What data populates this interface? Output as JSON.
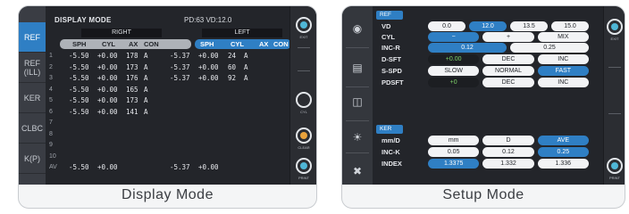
{
  "display_mode": {
    "caption": "Display Mode",
    "title": "DISPLAY MODE",
    "pd": "PD:63",
    "vd": "VD:12.0",
    "right_label": "RIGHT",
    "left_label": "LEFT",
    "sidebar": [
      {
        "label": "REF",
        "active": true
      },
      {
        "label": "REF\n(ILL)",
        "active": false
      },
      {
        "label": "KER",
        "active": false
      },
      {
        "label": "CLBC",
        "active": false
      },
      {
        "label": "K(P)",
        "active": false
      }
    ],
    "headers": [
      "SPH",
      "CYL",
      "AX",
      "CON",
      "SPH",
      "CYL",
      "AX",
      "CON"
    ],
    "rows": [
      {
        "n": "1",
        "r_sph": "-5.50",
        "r_cyl": "+0.00",
        "r_ax": "178",
        "r_con": "A",
        "l_sph": "-5.37",
        "l_cyl": "+0.00",
        "l_ax": "24",
        "l_con": "A"
      },
      {
        "n": "2",
        "r_sph": "-5.50",
        "r_cyl": "+0.00",
        "r_ax": "173",
        "r_con": "A",
        "l_sph": "-5.37",
        "l_cyl": "+0.00",
        "l_ax": "60",
        "l_con": "A"
      },
      {
        "n": "3",
        "r_sph": "-5.50",
        "r_cyl": "+0.00",
        "r_ax": "176",
        "r_con": "A",
        "l_sph": "-5.37",
        "l_cyl": "+0.00",
        "l_ax": "92",
        "l_con": "A"
      },
      {
        "n": "4",
        "r_sph": "-5.50",
        "r_cyl": "+0.00",
        "r_ax": "165",
        "r_con": "A",
        "l_sph": "",
        "l_cyl": "",
        "l_ax": "",
        "l_con": ""
      },
      {
        "n": "5",
        "r_sph": "-5.50",
        "r_cyl": "+0.00",
        "r_ax": "173",
        "r_con": "A",
        "l_sph": "",
        "l_cyl": "",
        "l_ax": "",
        "l_con": ""
      },
      {
        "n": "6",
        "r_sph": "-5.50",
        "r_cyl": "+0.00",
        "r_ax": "141",
        "r_con": "A",
        "l_sph": "",
        "l_cyl": "",
        "l_ax": "",
        "l_con": ""
      },
      {
        "n": "7",
        "r_sph": "",
        "r_cyl": "",
        "r_ax": "",
        "r_con": "",
        "l_sph": "",
        "l_cyl": "",
        "l_ax": "",
        "l_con": ""
      },
      {
        "n": "8",
        "r_sph": "",
        "r_cyl": "",
        "r_ax": "",
        "r_con": "",
        "l_sph": "",
        "l_cyl": "",
        "l_ax": "",
        "l_con": ""
      },
      {
        "n": "9",
        "r_sph": "",
        "r_cyl": "",
        "r_ax": "",
        "r_con": "",
        "l_sph": "",
        "l_cyl": "",
        "l_ax": "",
        "l_con": ""
      },
      {
        "n": "10",
        "r_sph": "",
        "r_cyl": "",
        "r_ax": "",
        "r_con": "",
        "l_sph": "",
        "l_cyl": "",
        "l_ax": "",
        "l_con": ""
      }
    ],
    "average": {
      "n": "AV",
      "r_sph": "-5.50",
      "r_cyl": "+0.00",
      "l_sph": "-5.37",
      "l_cyl": "+0.00"
    },
    "right_buttons": [
      {
        "label": "EXIT",
        "icon": "exit-icon",
        "color": "blue"
      },
      {
        "label": "CYL",
        "icon": "cyl-icon",
        "color": "blue"
      },
      {
        "label": "CLEAR",
        "icon": "clear-icon",
        "color": "orange"
      },
      {
        "label": "PRINT",
        "icon": "print-icon",
        "color": "blue"
      }
    ]
  },
  "setup_mode": {
    "caption": "Setup Mode",
    "ref_section": "REF",
    "ker_section": "KER",
    "rows": [
      {
        "label": "VD",
        "options": [
          "0.0",
          "12.0",
          "13.5",
          "15.0"
        ],
        "selected": 1
      },
      {
        "label": "CYL",
        "options": [
          "−",
          "+",
          "MIX"
        ],
        "selected": 0
      },
      {
        "label": "INC-R",
        "options": [
          "0.12",
          "0.25"
        ],
        "selected": 0
      },
      {
        "label": "D-SFT",
        "options": [
          "+0.00",
          "DEC",
          "INC"
        ],
        "selected": -1
      },
      {
        "label": "S-SPD",
        "options": [
          "SLOW",
          "NORMAL",
          "FAST"
        ],
        "selected": 2
      },
      {
        "label": "PDSFT",
        "options": [
          "+0",
          "DEC",
          "INC"
        ],
        "selected": -1
      },
      {
        "label": "mm/D",
        "options": [
          "mm",
          "D",
          "AVE"
        ],
        "selected": 2
      },
      {
        "label": "INC-K",
        "options": [
          "0.05",
          "0.12",
          "0.25"
        ],
        "selected": 2
      },
      {
        "label": "INDEX",
        "options": [
          "1.3375",
          "1.332",
          "1.336"
        ],
        "selected": 0
      }
    ],
    "right_buttons": [
      {
        "label": "EXIT",
        "icon": "exit-icon"
      },
      {
        "label": "PRINT",
        "icon": "print-icon"
      }
    ],
    "left_icons": [
      "eye-icon",
      "printer-icon",
      "network-icon",
      "brightness-icon",
      "tools-icon"
    ]
  }
}
